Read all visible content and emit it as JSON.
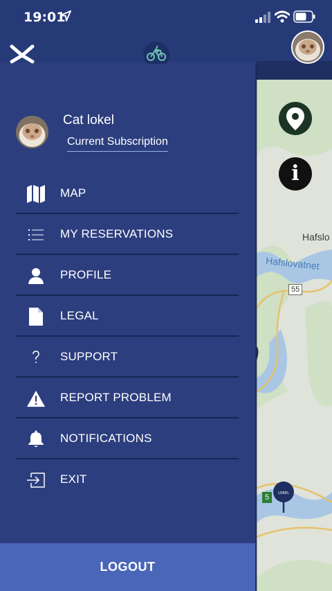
{
  "status_bar": {
    "time": "19:01"
  },
  "user": {
    "name": "Cat lokel",
    "subscription_label": "Current Subscription"
  },
  "menu": [
    {
      "label": "MAP",
      "icon": "map-icon"
    },
    {
      "label": "MY RESERVATIONS",
      "icon": "list-icon"
    },
    {
      "label": "PROFILE",
      "icon": "person-icon"
    },
    {
      "label": "LEGAL",
      "icon": "document-icon"
    },
    {
      "label": "SUPPORT",
      "icon": "question-icon"
    },
    {
      "label": "REPORT PROBLEM",
      "icon": "warning-icon"
    },
    {
      "label": "NOTIFICATIONS",
      "icon": "bell-icon"
    },
    {
      "label": "EXIT",
      "icon": "exit-icon"
    }
  ],
  "logout_label": "LOGOUT",
  "map": {
    "labels": {
      "place": "Hafslo",
      "lake": "Hafslovatnet"
    },
    "road_signs": [
      "55",
      "5"
    ],
    "info_glyph": "i",
    "pin_text": "LOKEL"
  },
  "colors": {
    "drawer": "#2c3e7e",
    "logout": "#4a66b8",
    "divider": "#162655"
  }
}
